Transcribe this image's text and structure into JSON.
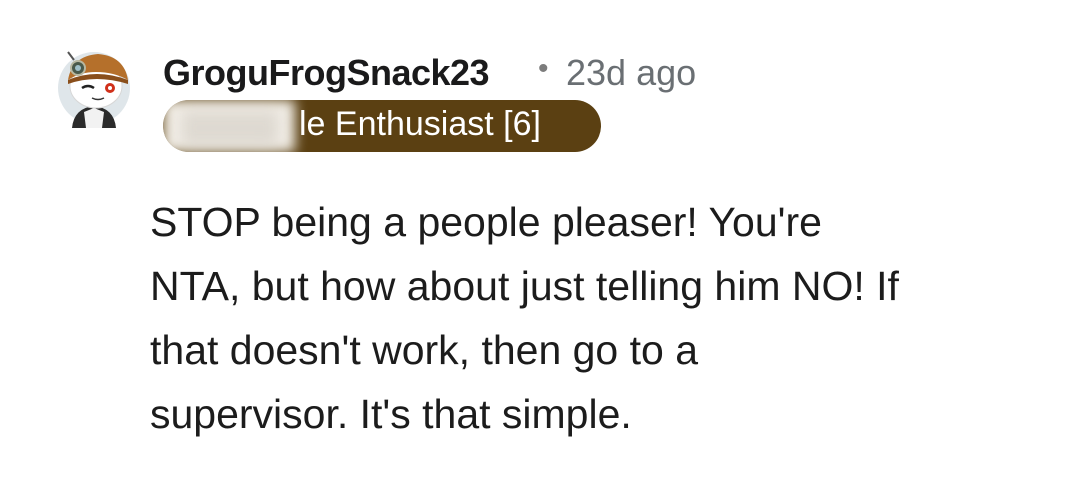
{
  "comment": {
    "username": "GroguFrogSnack23",
    "separator": "•",
    "timestamp": "23d ago",
    "flair": "le Enthusiast [6]",
    "body_lines": [
      "STOP being a people pleaser! You're",
      "NTA, but how about just telling him NO! If",
      "that doesn't work, then go to a",
      "supervisor. It's that simple."
    ]
  },
  "colors": {
    "flair_background": "#5b4012",
    "timestamp": "#6a6f73",
    "avatar_hat": "#b5702b"
  },
  "icons": {
    "avatar": "snoo-avatar-icon"
  }
}
